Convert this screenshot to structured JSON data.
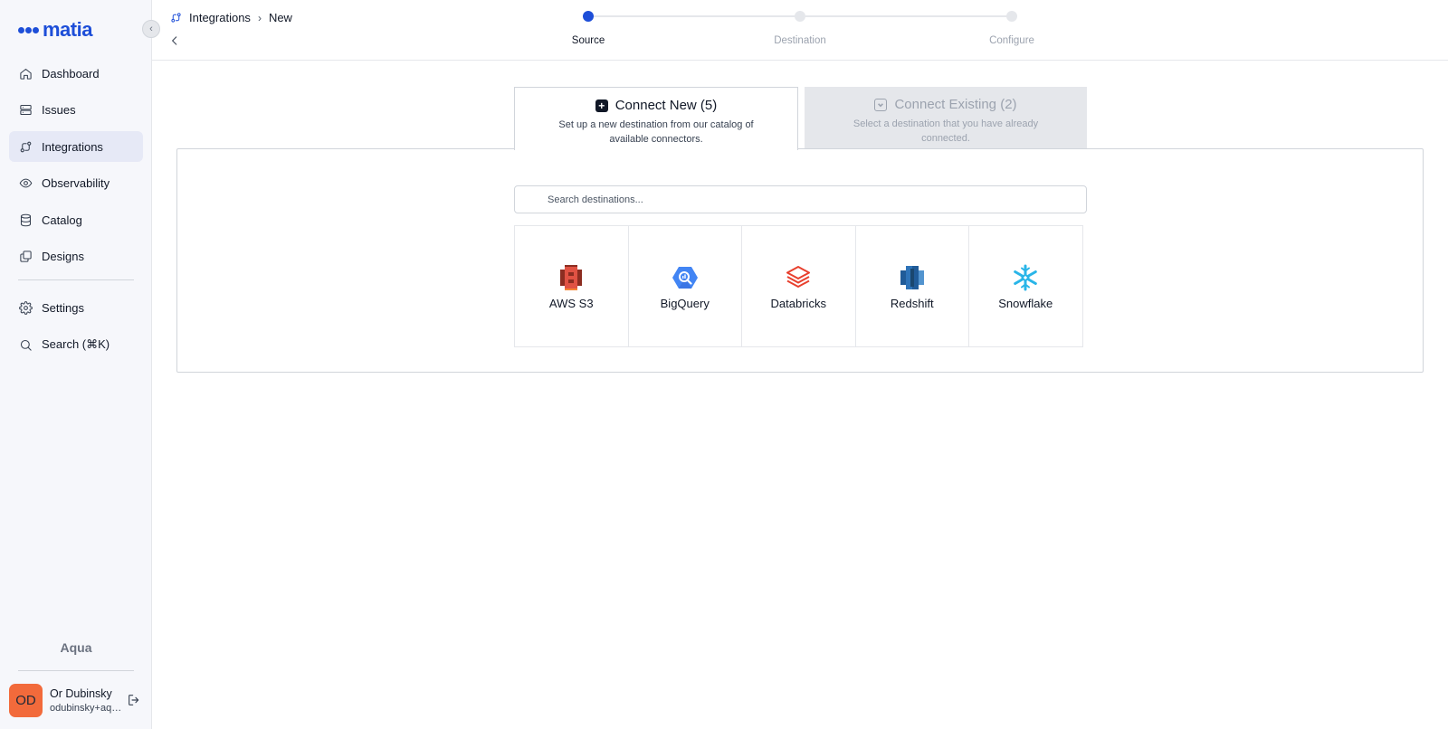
{
  "brand": {
    "name": "matia",
    "color": "#1d4ed8"
  },
  "sidebar": {
    "items": [
      {
        "label": "Dashboard",
        "icon": "home-icon",
        "active": false
      },
      {
        "label": "Issues",
        "icon": "server-icon",
        "active": false
      },
      {
        "label": "Integrations",
        "icon": "integrations-icon",
        "active": true
      },
      {
        "label": "Observability",
        "icon": "eye-icon",
        "active": false
      },
      {
        "label": "Catalog",
        "icon": "database-icon",
        "active": false
      },
      {
        "label": "Designs",
        "icon": "layers-icon",
        "active": false
      }
    ],
    "bottom_items": [
      {
        "label": "Settings",
        "icon": "gear-icon"
      },
      {
        "label": "Search (⌘K)",
        "icon": "search-icon"
      }
    ],
    "org_name": "Aqua",
    "user": {
      "initials": "OD",
      "name": "Or Dubinsky",
      "email": "odubinsky+aqua@matia.io"
    }
  },
  "header": {
    "breadcrumb": [
      "Integrations",
      "New"
    ],
    "steps": [
      {
        "label": "Source",
        "active": true
      },
      {
        "label": "Destination",
        "active": false
      },
      {
        "label": "Configure",
        "active": false
      }
    ]
  },
  "tabs": {
    "connect_new": {
      "title": "Connect New (5)",
      "description": "Set up a new destination from our catalog of available connectors."
    },
    "connect_existing": {
      "title": "Connect Existing (2)",
      "description": "Select a destination that you have already connected."
    }
  },
  "search": {
    "placeholder": "Search destinations..."
  },
  "destinations": [
    {
      "label": "AWS S3",
      "icon": "aws-s3-icon"
    },
    {
      "label": "BigQuery",
      "icon": "bigquery-icon"
    },
    {
      "label": "Databricks",
      "icon": "databricks-icon"
    },
    {
      "label": "Redshift",
      "icon": "redshift-icon"
    },
    {
      "label": "Snowflake",
      "icon": "snowflake-icon"
    }
  ]
}
